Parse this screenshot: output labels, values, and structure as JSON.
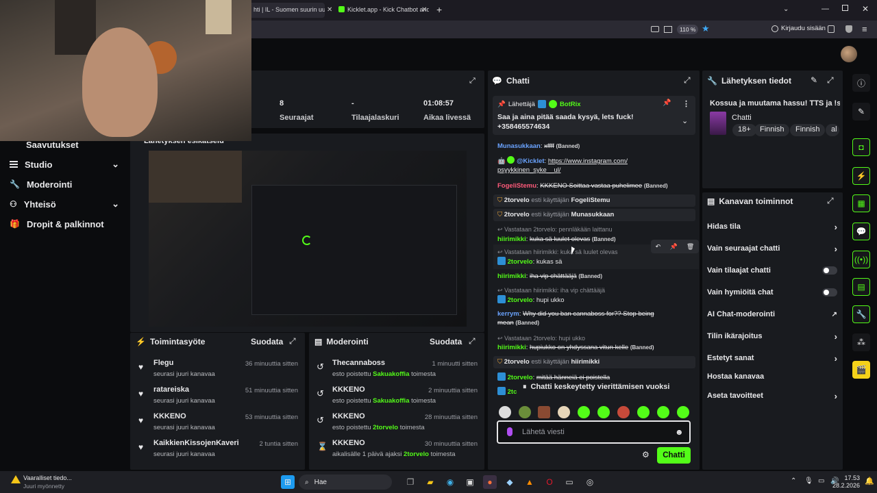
{
  "browser": {
    "tabs": [
      {
        "label": "hti | IL - Suomen suurin uu"
      },
      {
        "label": "Kicklet.app - Kick Chatbot and C"
      }
    ],
    "zoom": "110 %",
    "signin": "Kirjaudu sisään"
  },
  "sidebar": {
    "items": [
      {
        "label": "Saavutukset"
      },
      {
        "label": "Studio"
      },
      {
        "label": "Moderointi"
      },
      {
        "label": "Yhteisö"
      },
      {
        "label": "Dropit & palkinnot"
      }
    ]
  },
  "stats": [
    {
      "value": "8",
      "label": "Seuraajat"
    },
    {
      "value": "-",
      "label": "Tilaajalaskuri"
    },
    {
      "value": "01:08:57",
      "label": "Aikaa livessä"
    }
  ],
  "preview": {
    "title": "Lähetyksen esikatselu"
  },
  "activity": {
    "title": "Toimintasyöte",
    "filter": "Suodata",
    "items": [
      {
        "name": "Flegu",
        "sub": "seurasi juuri kanavaa",
        "time": "36 minuuttia sitten"
      },
      {
        "name": "ratareiska",
        "sub": "seurasi juuri kanavaa",
        "time": "51 minuuttia sitten"
      },
      {
        "name": "KKKENO",
        "sub": "seurasi juuri kanavaa",
        "time": "53 minuuttia sitten"
      },
      {
        "name": "KaikkienKissojenKaveri",
        "sub": "seurasi juuri kanavaa",
        "time": "2 tuntia sitten"
      }
    ]
  },
  "moderation": {
    "title": "Moderointi",
    "filter": "Suodata",
    "items": [
      {
        "name": "Thecannaboss",
        "pre": "esto poistettu",
        "who": "Sakuakoffia",
        "post": "toimesta",
        "time": "1 minuutti sitten"
      },
      {
        "name": "KKKENO",
        "pre": "esto poistettu",
        "who": "Sakuakoffia",
        "post": "toimesta",
        "time": "2 minuuttia sitten"
      },
      {
        "name": "KKKENO",
        "pre": "esto poistettu",
        "who": "2torvelo",
        "post": "toimesta",
        "time": "28 minuuttia sitten"
      },
      {
        "name": "KKKENO",
        "pre": "aikalisälle 1 päivä ajaksi",
        "who": "2torvelo",
        "post": "toimesta",
        "time": "30 minuuttia sitten"
      }
    ]
  },
  "chat": {
    "title": "Chatti",
    "pinned": {
      "label": "Lähettäjä",
      "user": "BotRix",
      "text": "Saa ja aina pitää saada kysyä, lets fuck! +358465574634"
    },
    "banned": "(Banned)",
    "m1": {
      "user": "Munasukkaan",
      "text": "xffff"
    },
    "m2": {
      "user": "@Kicklet",
      "link": "https://www.instagram.com/",
      "link2": "psyykkinen_syke__ul/"
    },
    "m3": {
      "user": "FogeliStemu",
      "text": "KKKENO Soittaa vastaa puhelimee"
    },
    "sys1": {
      "user": "2torvelo",
      "mid": "esti käyttäjän",
      "target": "FogeliStemu"
    },
    "sys2": {
      "user": "2torvelo",
      "mid": "esti käyttäjän",
      "target": "Munasukkaan"
    },
    "r1": "Vastataan 2torvelo: pennläkään laittanu",
    "m4": {
      "user": "hiirimikki",
      "text": "kuka sä luulet olevas"
    },
    "r2": "Vastataan hiirimikki: kuka sä luulet olevas",
    "m5": {
      "user": "2torvelo",
      "text": "kukas sä"
    },
    "m6": {
      "user": "hiirimikki",
      "text": "iha vip chättääjä"
    },
    "r3": "Vastataan hiirimikki: iha vip chättääjä",
    "m7": {
      "user": "2torvelo",
      "text": "hupi ukko"
    },
    "m8": {
      "user": "kerrym",
      "text": "Why did you ban cannaboss for?? Stop being",
      "text2": "mean"
    },
    "r4": "Vastataan 2torvelo: hupi ukko",
    "m9": {
      "user": "hiirimikki",
      "text": "hupiukko on yhdyssana vitun kelle"
    },
    "sys3": {
      "user": "2torvelo",
      "mid": "esti käyttäjän",
      "target": "hiirimikki"
    },
    "m10": {
      "user": "2torvelo",
      "text": "mitää hänneiä ei poistella"
    },
    "m11": {
      "user": "2tc"
    },
    "paused": "Chatti keskeytetty vierittämisen vuoksi",
    "placeholder": "Lähetä viesti",
    "send": "Chatti"
  },
  "stream_info": {
    "title": "Lähetyksen tiedot",
    "stream_title": "Kossua ja muutama hassu! TTS ja !sr",
    "category": "Chatti",
    "tags": [
      "18+",
      "Finnish",
      "Finnish",
      "al"
    ]
  },
  "channel_actions": {
    "title": "Kanavan toiminnot",
    "items": [
      {
        "label": "Hidas tila",
        "kind": "chevron"
      },
      {
        "label": "Vain seuraajat chatti",
        "kind": "chevron"
      },
      {
        "label": "Vain tilaajat chatti",
        "kind": "toggle"
      },
      {
        "label": "Vain hymiöitä chat",
        "kind": "toggle"
      },
      {
        "label": "AI Chat-moderointi",
        "kind": "external"
      },
      {
        "label": "Tilin ikärajoitus",
        "kind": "chevron"
      },
      {
        "label": "Estetyt sanat",
        "kind": "chevron"
      },
      {
        "label": "Hostaa kanavaa",
        "kind": "none"
      },
      {
        "label": "Aseta tavoitteet",
        "kind": "chevron"
      }
    ]
  },
  "taskbar": {
    "notif_title": "Vaaralliset tiedo...",
    "notif_sub": "Juuri myönnetty",
    "search": "Hae",
    "time": "17.53",
    "date": "28.2.2026"
  },
  "colors": {
    "accent": "#53fc18",
    "panel": "#191b1f",
    "bg": "#0b0c0e"
  }
}
